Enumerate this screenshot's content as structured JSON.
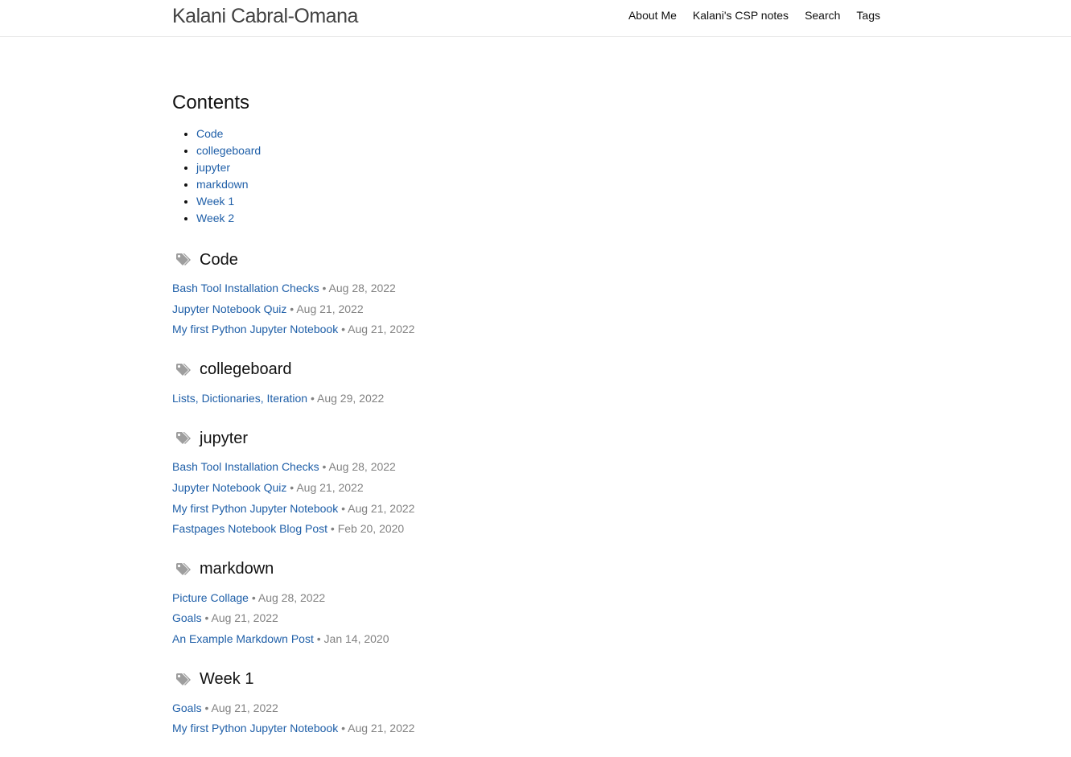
{
  "header": {
    "site_title": "Kalani Cabral-Omana",
    "nav": [
      {
        "label": "About Me"
      },
      {
        "label": "Kalani's CSP notes"
      },
      {
        "label": "Search"
      },
      {
        "label": "Tags"
      }
    ]
  },
  "contents": {
    "title": "Contents",
    "items": [
      "Code",
      "collegeboard",
      "jupyter",
      "markdown",
      "Week 1",
      "Week 2"
    ]
  },
  "separator": " • ",
  "tags": [
    {
      "name": "Code",
      "posts": [
        {
          "title": "Bash Tool Installation Checks",
          "date": "Aug 28, 2022"
        },
        {
          "title": "Jupyter Notebook Quiz",
          "date": "Aug 21, 2022"
        },
        {
          "title": "My first Python Jupyter Notebook",
          "date": "Aug 21, 2022"
        }
      ]
    },
    {
      "name": "collegeboard",
      "posts": [
        {
          "title": "Lists, Dictionaries, Iteration",
          "date": "Aug 29, 2022"
        }
      ]
    },
    {
      "name": "jupyter",
      "posts": [
        {
          "title": "Bash Tool Installation Checks",
          "date": "Aug 28, 2022"
        },
        {
          "title": "Jupyter Notebook Quiz",
          "date": "Aug 21, 2022"
        },
        {
          "title": "My first Python Jupyter Notebook",
          "date": "Aug 21, 2022"
        },
        {
          "title": "Fastpages Notebook Blog Post",
          "date": "Feb 20, 2020"
        }
      ]
    },
    {
      "name": "markdown",
      "posts": [
        {
          "title": "Picture Collage",
          "date": "Aug 28, 2022"
        },
        {
          "title": "Goals",
          "date": "Aug 21, 2022"
        },
        {
          "title": "An Example Markdown Post",
          "date": "Jan 14, 2020"
        }
      ]
    },
    {
      "name": "Week 1",
      "posts": [
        {
          "title": "Goals",
          "date": "Aug 21, 2022"
        },
        {
          "title": "My first Python Jupyter Notebook",
          "date": "Aug 21, 2022"
        }
      ]
    }
  ],
  "colors": {
    "link": "#1f5fa8",
    "date": "#828282",
    "tag_icon": "#9e9e9e"
  },
  "icons": {
    "tag": "tags-icon"
  }
}
